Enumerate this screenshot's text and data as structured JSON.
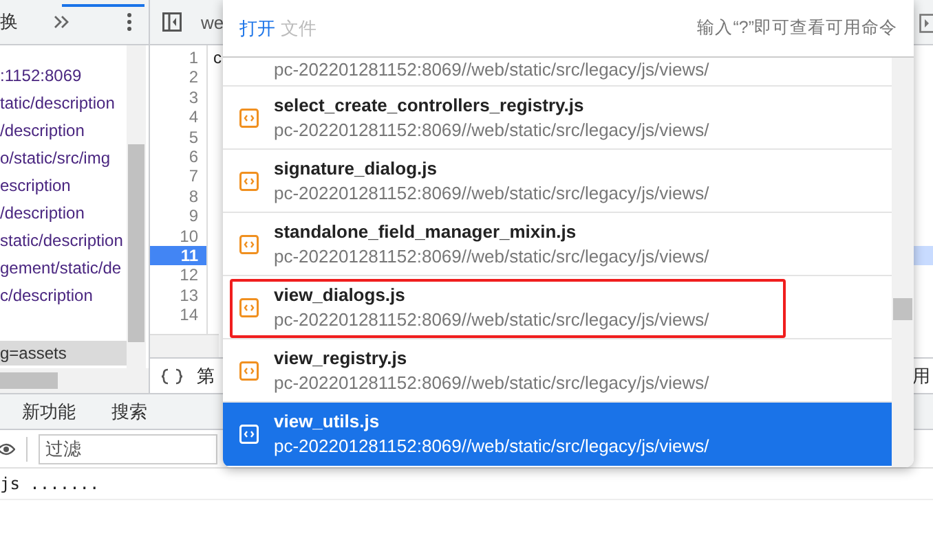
{
  "sidebar": {
    "tab": "换",
    "items": [
      {
        "label": ":1152:8069",
        "selected": false
      },
      {
        "label": "tatic/description",
        "selected": false
      },
      {
        "label": "/description",
        "selected": false
      },
      {
        "label": "o/static/src/img",
        "selected": false
      },
      {
        "label": "escription",
        "selected": false
      },
      {
        "label": "/description",
        "selected": false
      },
      {
        "label": "static/description",
        "selected": false
      },
      {
        "label": "gement/static/de",
        "selected": false
      },
      {
        "label": "c/description",
        "selected": false
      },
      {
        "label": "g=assets",
        "selected": true
      }
    ]
  },
  "editor": {
    "tab": "we",
    "code": "c",
    "lines": [
      {
        "number": "1",
        "selected": false
      },
      {
        "number": "2",
        "selected": false
      },
      {
        "number": "3",
        "selected": false
      },
      {
        "number": "4",
        "selected": false
      },
      {
        "number": "5",
        "selected": false
      },
      {
        "number": "6",
        "selected": false
      },
      {
        "number": "7",
        "selected": false
      },
      {
        "number": "8",
        "selected": false
      },
      {
        "number": "9",
        "selected": false
      },
      {
        "number": "10",
        "selected": false
      },
      {
        "number": "11",
        "selected": true
      },
      {
        "number": "12",
        "selected": false
      },
      {
        "number": "13",
        "selected": false
      },
      {
        "number": "14",
        "selected": false
      }
    ],
    "status": "第",
    "status_right": "用"
  },
  "drawer": {
    "tabs": [
      "新功能",
      "搜索"
    ],
    "filter": {
      "placeholder": "过滤"
    },
    "console_line": "js ......."
  },
  "palette": {
    "prefix": "打开",
    "placeholder": "文件",
    "hint": "输入“?”即可查看可用命令",
    "items": [
      {
        "path": "pc-202201281152:8069//web/static/src/legacy/js/views/",
        "selected": false,
        "highlighted": false
      },
      {
        "name": "select_create_controllers_registry.js",
        "path": "pc-202201281152:8069//web/static/src/legacy/js/views/",
        "selected": false,
        "highlighted": false
      },
      {
        "name": "signature_dialog.js",
        "path": "pc-202201281152:8069//web/static/src/legacy/js/views/",
        "selected": false,
        "highlighted": false
      },
      {
        "name": "standalone_field_manager_mixin.js",
        "path": "pc-202201281152:8069//web/static/src/legacy/js/views/",
        "selected": false,
        "highlighted": false
      },
      {
        "name": "view_dialogs.js",
        "path": "pc-202201281152:8069//web/static/src/legacy/js/views/",
        "selected": false,
        "highlighted": true
      },
      {
        "name": "view_registry.js",
        "path": "pc-202201281152:8069//web/static/src/legacy/js/views/",
        "selected": false,
        "highlighted": false
      },
      {
        "name": "view_utils.js",
        "path": "pc-202201281152:8069//web/static/src/legacy/js/views/",
        "selected": true,
        "highlighted": false
      }
    ]
  }
}
